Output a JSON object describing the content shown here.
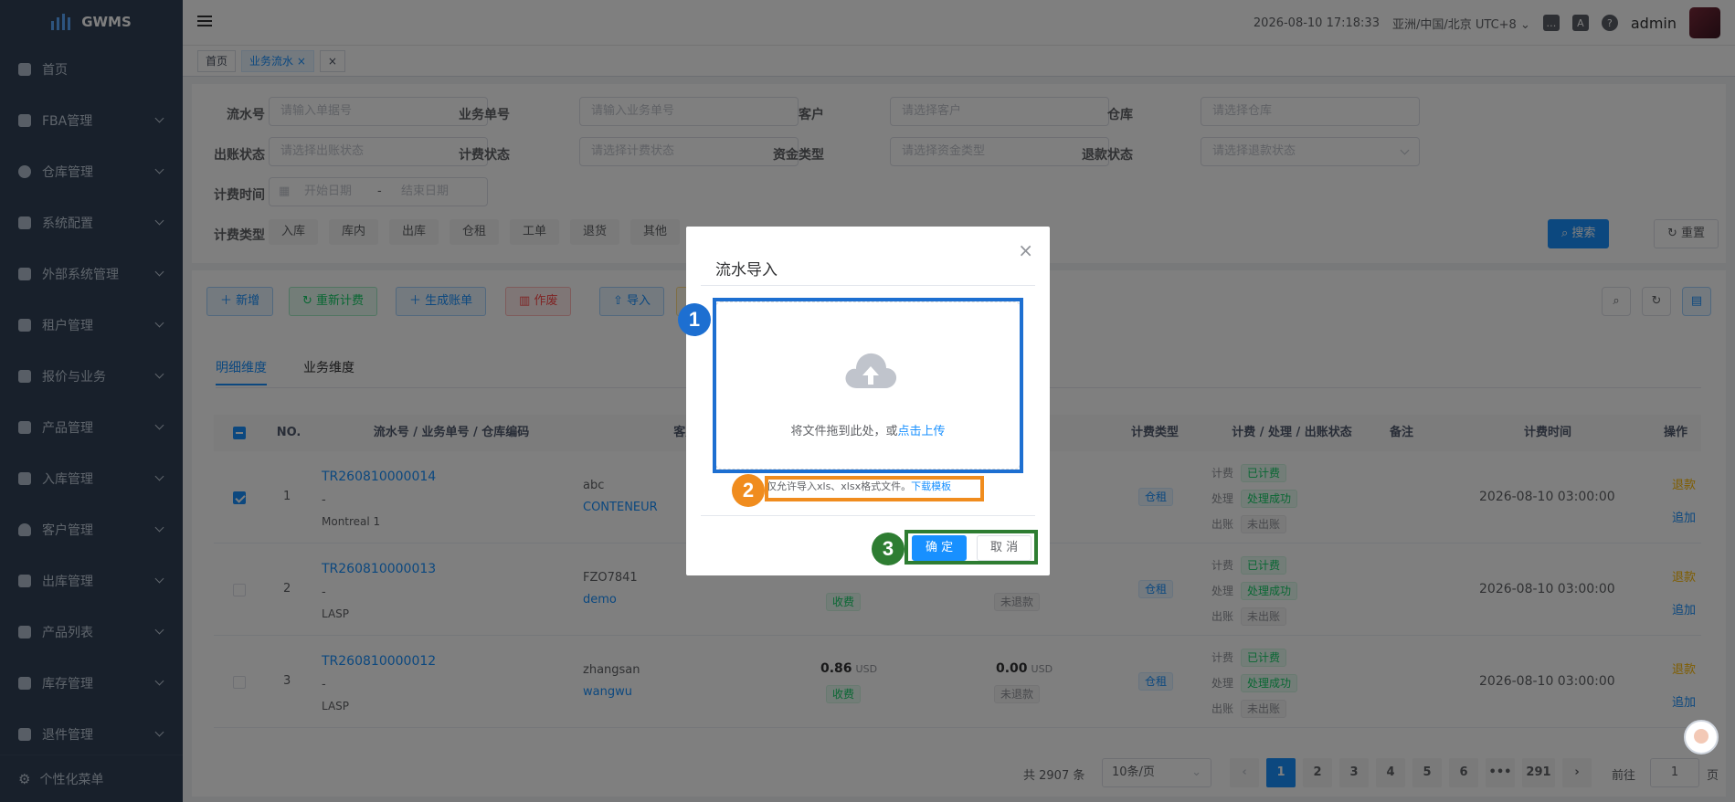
{
  "app": {
    "name": "GWMS"
  },
  "sidebar": {
    "items": [
      {
        "label": "首页",
        "has_children": false
      },
      {
        "label": "FBA管理",
        "has_children": true
      },
      {
        "label": "仓库管理",
        "has_children": true
      },
      {
        "label": "系统配置",
        "has_children": true
      },
      {
        "label": "外部系统管理",
        "has_children": true
      },
      {
        "label": "租户管理",
        "has_children": true
      },
      {
        "label": "报价与业务",
        "has_children": true
      },
      {
        "label": "产品管理",
        "has_children": true
      },
      {
        "label": "入库管理",
        "has_children": true
      },
      {
        "label": "客户管理",
        "has_children": true
      },
      {
        "label": "出库管理",
        "has_children": true
      },
      {
        "label": "产品列表",
        "has_children": true
      },
      {
        "label": "库存管理",
        "has_children": true
      },
      {
        "label": "退件管理",
        "has_children": true
      }
    ],
    "footer_label": "个性化菜单"
  },
  "navbar": {
    "datetime": "2026-08-10 17:18:33",
    "timezone": "亚洲/中国/北京 UTC+8",
    "user": "admin",
    "icons": [
      "message-icon",
      "translate-icon",
      "help-icon"
    ]
  },
  "tags": [
    {
      "label": "首页",
      "active": false
    },
    {
      "label": "业务流水",
      "active": true,
      "close": "×"
    },
    {
      "label": "×",
      "active": false
    }
  ],
  "filters": {
    "serial_no": {
      "label": "流水号",
      "placeholder": "请输入单据号"
    },
    "business_no": {
      "label": "业务单号",
      "placeholder": "请输入业务单号"
    },
    "customer": {
      "label": "客户",
      "placeholder": "请选择客户"
    },
    "warehouse": {
      "label": "仓库",
      "placeholder": "请选择仓库"
    },
    "billing_status": {
      "label": "出账状态",
      "placeholder": "请选择出账状态"
    },
    "charge_status": {
      "label": "计费状态",
      "placeholder": "请选择计费状态"
    },
    "fund_type": {
      "label": "资金类型",
      "placeholder": "请选择资金类型"
    },
    "refund_status": {
      "label": "退款状态",
      "placeholder": "请选择退款状态"
    },
    "charge_time": {
      "label": "计费时间",
      "start": "开始日期",
      "sep": "-",
      "end": "结束日期"
    },
    "fee_type": {
      "label": "计费类型",
      "options": [
        "入库",
        "库内",
        "出库",
        "仓租",
        "工单",
        "退货",
        "其他"
      ]
    },
    "search_label": "搜索",
    "reset_label": "重置"
  },
  "toolbar": {
    "add": "新增",
    "recharge": "重新计费",
    "generate_bill": "生成账单",
    "void": "作废",
    "import": "导入"
  },
  "tabs": [
    "明细维度",
    "业务维度"
  ],
  "table": {
    "columns": [
      "NO.",
      "流水号 / 业务单号 / 仓库编码",
      "客户代码 / 业务名",
      "计费类型",
      "计费 / 处理 / 出账状态",
      "备注",
      "计费时间",
      "操作"
    ],
    "rows": [
      {
        "no": "1",
        "serial": "TR260810000014",
        "biz": "-",
        "wh": "Montreal 1",
        "cust_code": "abc",
        "cust_name": "CONTENEUR",
        "amount": "",
        "amount_unit": "",
        "amount_tag": "",
        "refund": "",
        "refund_unit": "",
        "refund_tag": "",
        "fee_type": "仓租",
        "s_charge": "已计费",
        "s_process": "处理成功",
        "s_bill": "未出账",
        "time": "2026-08-10 03:00:00",
        "op1": "退款",
        "op2": "追加",
        "checked": true
      },
      {
        "no": "2",
        "serial": "TR260810000013",
        "biz": "-",
        "wh": "LASP",
        "cust_code": "FZO7841",
        "cust_name": "demo",
        "amount": "",
        "amount_unit": "",
        "amount_tag": "收费",
        "refund": "",
        "refund_unit": "",
        "refund_tag": "未退款",
        "fee_type": "仓租",
        "s_charge": "已计费",
        "s_process": "处理成功",
        "s_bill": "未出账",
        "time": "2026-08-10 03:00:00",
        "op1": "退款",
        "op2": "追加",
        "checked": false
      },
      {
        "no": "3",
        "serial": "TR260810000012",
        "biz": "-",
        "wh": "LASP",
        "cust_code": "zhangsan",
        "cust_name": "wangwu",
        "amount": "0.86",
        "amount_unit": "USD",
        "amount_tag": "收费",
        "refund": "0.00",
        "refund_unit": "USD",
        "refund_tag": "未退款",
        "fee_type": "仓租",
        "s_charge": "已计费",
        "s_process": "处理成功",
        "s_bill": "未出账",
        "time": "2026-08-10 03:00:00",
        "op1": "退款",
        "op2": "追加",
        "checked": false
      }
    ],
    "status_labels": {
      "charge": "计费",
      "process": "处理",
      "bill": "出账"
    }
  },
  "pagination": {
    "total": "共 2907 条",
    "page_size": "10条/页",
    "pages": [
      "1",
      "2",
      "3",
      "4",
      "5",
      "6",
      "•••",
      "291"
    ],
    "current": "1",
    "goto_label": "前往",
    "goto_value": "1",
    "page_suffix": "页"
  },
  "dialog": {
    "title": "流水导入",
    "close": "×",
    "drop_text": "将文件拖到此处，或",
    "upload_link": "点击上传",
    "tip": "仅允许导入xls、xlsx格式文件。",
    "template_link": "下载模板",
    "confirm": "确 定",
    "cancel": "取 消"
  },
  "annotations": [
    {
      "number": "1",
      "color": "#1d6fd1"
    },
    {
      "number": "2",
      "color": "#f08c1e"
    },
    {
      "number": "3",
      "color": "#2e7d32"
    }
  ]
}
